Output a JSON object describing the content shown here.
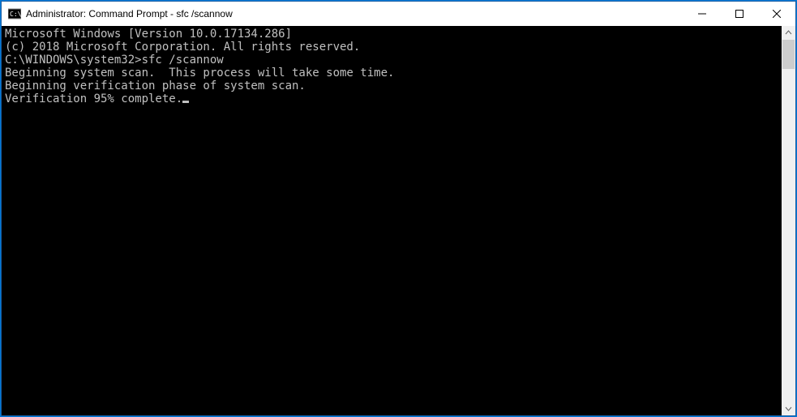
{
  "window": {
    "title": "Administrator: Command Prompt - sfc  /scannow"
  },
  "terminal": {
    "lines": [
      "Microsoft Windows [Version 10.0.17134.286]",
      "(c) 2018 Microsoft Corporation. All rights reserved.",
      "",
      "C:\\WINDOWS\\system32>sfc /scannow",
      "",
      "Beginning system scan.  This process will take some time.",
      "",
      "Beginning verification phase of system scan.",
      "Verification 95% complete."
    ],
    "cursor_after_last": true
  }
}
